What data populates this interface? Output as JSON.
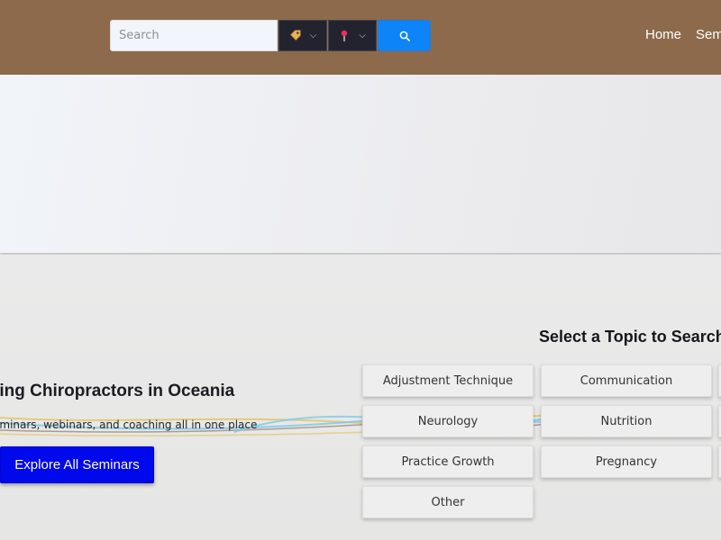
{
  "header": {
    "search": {
      "placeholder": "Search",
      "value": ""
    },
    "category_icon": "tag-icon",
    "location_icon": "pin-icon",
    "search_icon": "magnifier-icon",
    "nav": {
      "home": "Home",
      "seminars": "Seminars"
    }
  },
  "hero": {
    "title": "ring Chiropractors in Oceania",
    "subtitle": "eminars, webinars, and coaching all in one place",
    "explore_label": "Explore All Seminars"
  },
  "topics": {
    "title": "Select a Topic to Search",
    "items": [
      "Adjustment Technique",
      "Communication",
      "Neurology",
      "Nutrition",
      "Practice Growth",
      "Pregnancy",
      "Other"
    ]
  },
  "colors": {
    "header_bg": "#8c6a4b",
    "search_button": "#0d84f7",
    "explore_button": "#0008ec",
    "dropdown_bg": "#23232f"
  }
}
